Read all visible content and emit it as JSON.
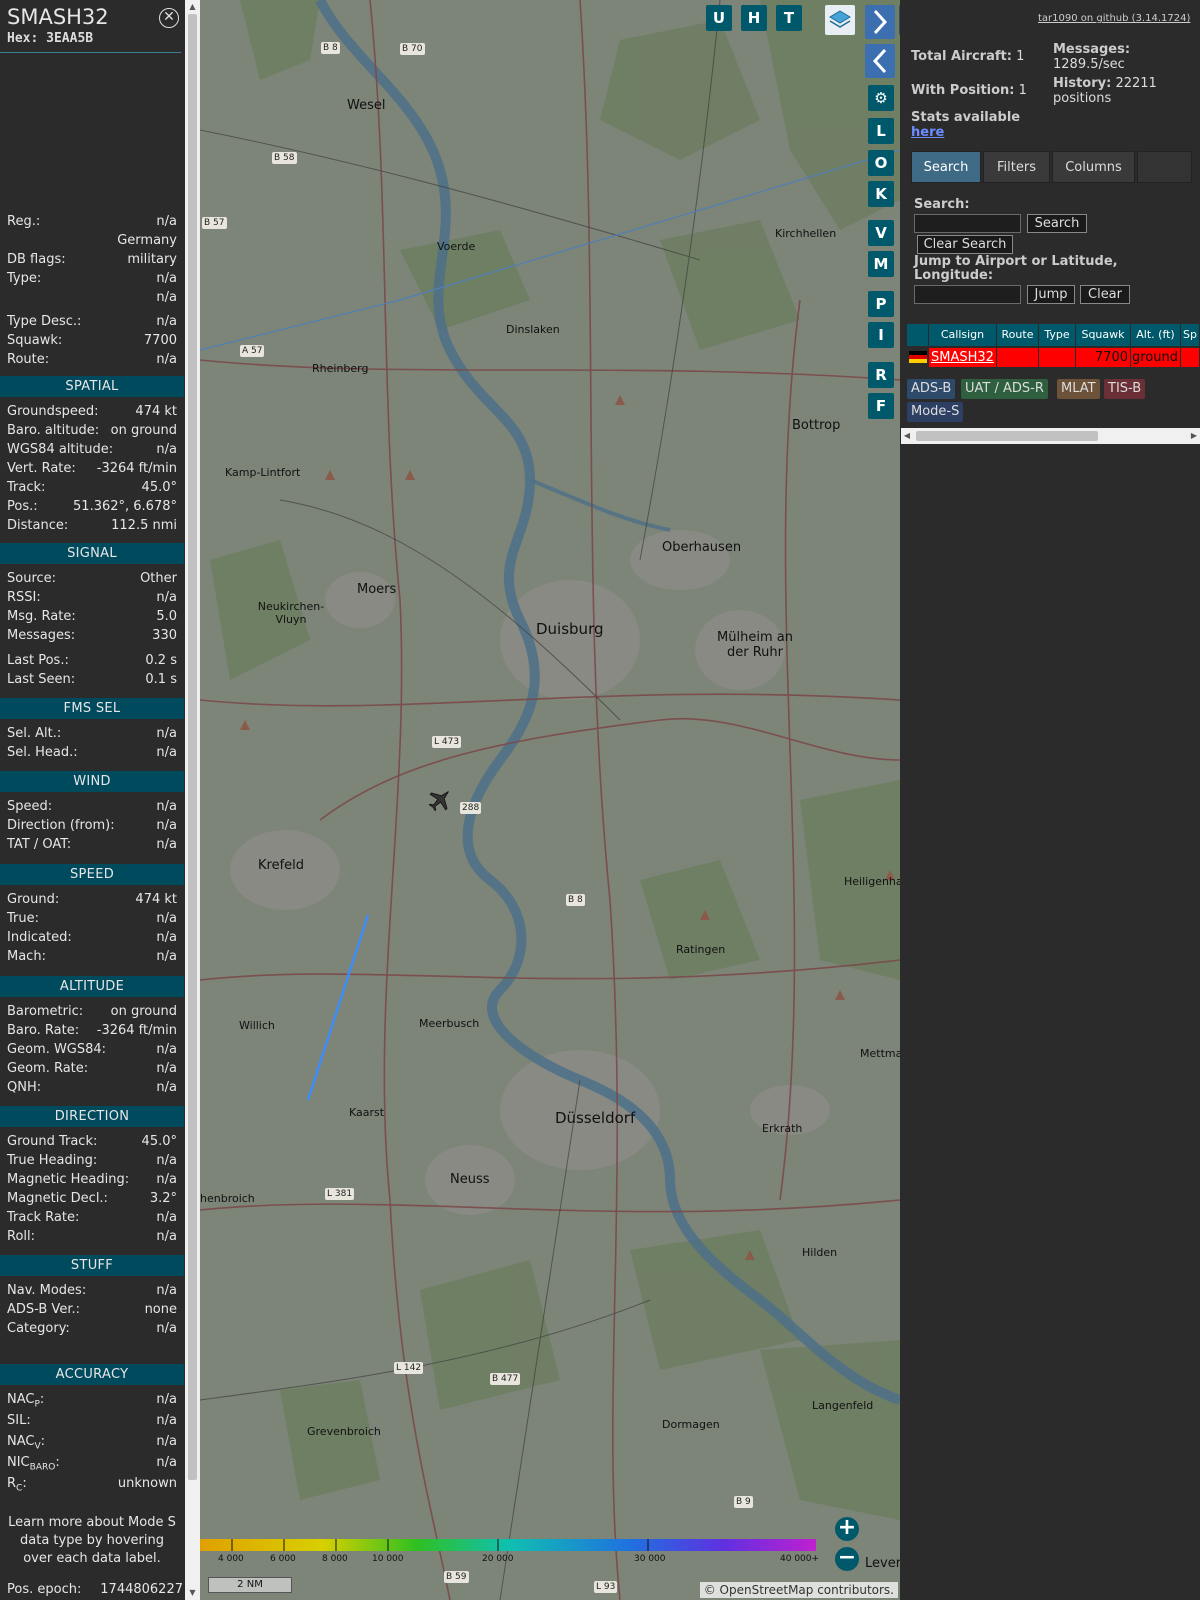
{
  "aircraft": {
    "callsign": "SMASH32",
    "hex_label": "Hex:",
    "hex": "3EAA5B"
  },
  "info_top": [
    {
      "label": "Reg.:",
      "value": "n/a"
    },
    {
      "label": "",
      "value": "Germany"
    },
    {
      "label": "DB flags:",
      "value": "military"
    },
    {
      "label": "Type:",
      "value": "n/a"
    },
    {
      "label": "",
      "value": "n/a"
    },
    {
      "label": "Type Desc.:",
      "value": "n/a"
    },
    {
      "label": "Squawk:",
      "value": "7700"
    },
    {
      "label": "Route:",
      "value": "n/a"
    }
  ],
  "sections": {
    "spatial": {
      "title": "SPATIAL",
      "rows": [
        {
          "label": "Groundspeed:",
          "value": "474 kt"
        },
        {
          "label": "Baro. altitude:",
          "value": "on ground"
        },
        {
          "label": "WGS84 altitude:",
          "value": "n/a"
        },
        {
          "label": "Vert. Rate:",
          "value": "-3264 ft/min"
        },
        {
          "label": "Track:",
          "value": "45.0°"
        },
        {
          "label": "Pos.:",
          "value": "51.362°, 6.678°"
        },
        {
          "label": "Distance:",
          "value": "112.5 nmi"
        }
      ]
    },
    "signal": {
      "title": "SIGNAL",
      "rows": [
        {
          "label": "Source:",
          "value": "Other"
        },
        {
          "label": "RSSI:",
          "value": "n/a"
        },
        {
          "label": "Msg. Rate:",
          "value": "5.0"
        },
        {
          "label": "Messages:",
          "value": "330"
        },
        {
          "label": "Last Pos.:",
          "value": "0.2 s"
        },
        {
          "label": "Last Seen:",
          "value": "0.1 s"
        }
      ]
    },
    "fms": {
      "title": "FMS SEL",
      "rows": [
        {
          "label": "Sel. Alt.:",
          "value": "n/a"
        },
        {
          "label": "Sel. Head.:",
          "value": "n/a"
        }
      ]
    },
    "wind": {
      "title": "WIND",
      "rows": [
        {
          "label": "Speed:",
          "value": "n/a"
        },
        {
          "label": "Direction (from):",
          "value": "n/a"
        },
        {
          "label": "TAT / OAT:",
          "value": "n/a"
        }
      ]
    },
    "speed": {
      "title": "SPEED",
      "rows": [
        {
          "label": "Ground:",
          "value": "474 kt"
        },
        {
          "label": "True:",
          "value": "n/a"
        },
        {
          "label": "Indicated:",
          "value": "n/a"
        },
        {
          "label": "Mach:",
          "value": "n/a"
        }
      ]
    },
    "altitude": {
      "title": "ALTITUDE",
      "rows": [
        {
          "label": "Barometric:",
          "value": "on ground"
        },
        {
          "label": "Baro. Rate:",
          "value": "-3264 ft/min"
        },
        {
          "label": "Geom. WGS84:",
          "value": "n/a"
        },
        {
          "label": "Geom. Rate:",
          "value": "n/a"
        },
        {
          "label": "QNH:",
          "value": "n/a"
        }
      ]
    },
    "direction": {
      "title": "DIRECTION",
      "rows": [
        {
          "label": "Ground Track:",
          "value": "45.0°"
        },
        {
          "label": "True Heading:",
          "value": "n/a"
        },
        {
          "label": "Magnetic Heading:",
          "value": "n/a"
        },
        {
          "label": "Magnetic Decl.:",
          "value": "3.2°"
        },
        {
          "label": "Track Rate:",
          "value": "n/a"
        },
        {
          "label": "Roll:",
          "value": "n/a"
        }
      ]
    },
    "stuff": {
      "title": "STUFF",
      "rows": [
        {
          "label": "Nav. Modes:",
          "value": "n/a"
        },
        {
          "label": "ADS-B Ver.:",
          "value": "none"
        },
        {
          "label": "Category:",
          "value": "n/a"
        }
      ]
    },
    "accuracy": {
      "title": "ACCURACY",
      "rows": [
        {
          "label": "NAC",
          "sub": "P",
          "value": "n/a"
        },
        {
          "label": "SIL:",
          "sub": "",
          "value": "n/a"
        },
        {
          "label": "NAC",
          "sub": "V",
          "value": "n/a"
        },
        {
          "label": "NIC",
          "sub": "BARO",
          "value": "n/a"
        },
        {
          "label": "R",
          "sub": "C",
          "value": "unknown"
        }
      ]
    }
  },
  "info_note": "Learn more about Mode S data type by hovering over each data label.",
  "pos_epoch": {
    "label": "Pos. epoch:",
    "value": "1744806227"
  },
  "map": {
    "toolbar_buttons": [
      "U",
      "H",
      "T"
    ],
    "side_buttons": [
      "L",
      "O",
      "K",
      "V",
      "M",
      "P",
      "I",
      "R",
      "F"
    ],
    "places": [
      {
        "name": "Wesel"
      },
      {
        "name": "Voerde"
      },
      {
        "name": "Dinslaken"
      },
      {
        "name": "Rheinberg"
      },
      {
        "name": "Kamp-Lintfort"
      },
      {
        "name": "Kirchhellen"
      },
      {
        "name": "Bottrop"
      },
      {
        "name": "Oberhausen"
      },
      {
        "name": "Moers"
      },
      {
        "name": "Neukirchen-Vluyn"
      },
      {
        "name": "Duisburg"
      },
      {
        "name": "Mülheim an der Ruhr"
      },
      {
        "name": "Krefeld"
      },
      {
        "name": "Ratingen"
      },
      {
        "name": "Meerbusch"
      },
      {
        "name": "Willich"
      },
      {
        "name": "Kaarst"
      },
      {
        "name": "Düsseldorf"
      },
      {
        "name": "Erkrath"
      },
      {
        "name": "Neuss"
      },
      {
        "name": "Hilden"
      },
      {
        "name": "Grevenbroich"
      },
      {
        "name": "Dormagen"
      },
      {
        "name": "Langenfeld"
      },
      {
        "name": "Heiligenha"
      },
      {
        "name": "Mettma"
      },
      {
        "name": "henbroich"
      },
      {
        "name": "Lever"
      }
    ],
    "road_labels": [
      "B 8",
      "B 70",
      "B 58",
      "B 57",
      "A 57",
      "L 473",
      "288",
      "B 8",
      "L 381",
      "L 142",
      "B 477",
      "B 9",
      "B 59",
      "L 93"
    ],
    "colorbar_ticks": [
      "4 000",
      "6 000",
      "8 000",
      "10 000",
      "20 000",
      "30 000",
      "40 000+"
    ],
    "scale_label": "2 NM",
    "attribution": "© OpenStreetMap contributors."
  },
  "sidebar": {
    "version_link": "tar1090 on github (3.14.1724)",
    "total_aircraft_label": "Total Aircraft:",
    "total_aircraft": "1",
    "with_position_label": "With Position:",
    "with_position": "1",
    "messages_label": "Messages:",
    "messages_value": "1289.5/sec",
    "history_label": "History:",
    "history_value": "22211",
    "history_unit": "positions",
    "stats_label": "Stats available",
    "stats_link": "here",
    "tabs": [
      "Search",
      "Filters",
      "Columns"
    ],
    "search_label": "Search:",
    "search_button": "Search",
    "clear_search_button": "Clear Search",
    "jump_label": "Jump to Airport or Latitude, Longitude:",
    "jump_button": "Jump",
    "clear_button": "Clear",
    "table_headers": [
      "",
      "Callsign",
      "Route",
      "Type",
      "Squawk",
      "Alt. (ft)",
      "Sp"
    ],
    "table_row": {
      "callsign": "SMASH32",
      "route": "",
      "type": "",
      "squawk": "7700",
      "alt": "ground"
    },
    "legend": [
      {
        "label": "ADS-B",
        "color": "#2d4a6b"
      },
      {
        "label": "UAT / ADS-R",
        "color": "#2e5f3f"
      },
      {
        "label": "MLAT",
        "color": "#6b5239"
      },
      {
        "label": "TIS-B",
        "color": "#6b2f36"
      },
      {
        "label": "Mode-S",
        "color": "#2d3f63"
      }
    ]
  }
}
